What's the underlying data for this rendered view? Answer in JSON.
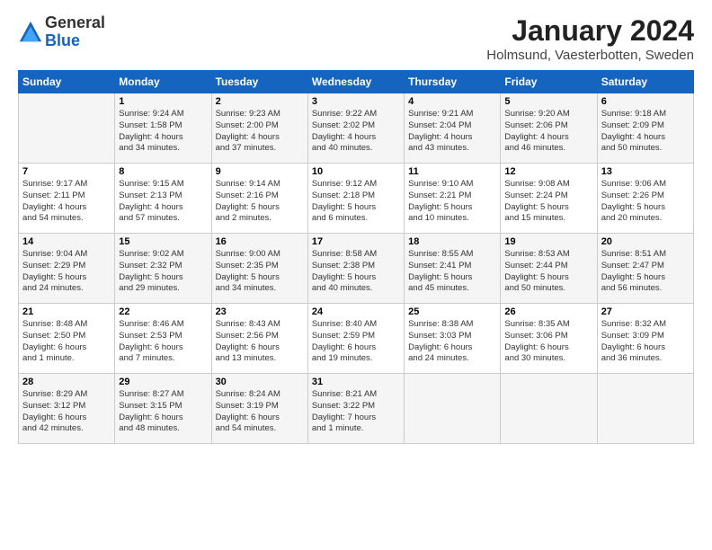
{
  "logo": {
    "general": "General",
    "blue": "Blue"
  },
  "title": "January 2024",
  "subtitle": "Holmsund, Vaesterbotten, Sweden",
  "days_header": [
    "Sunday",
    "Monday",
    "Tuesday",
    "Wednesday",
    "Thursday",
    "Friday",
    "Saturday"
  ],
  "weeks": [
    [
      {
        "num": "",
        "info": ""
      },
      {
        "num": "1",
        "info": "Sunrise: 9:24 AM\nSunset: 1:58 PM\nDaylight: 4 hours\nand 34 minutes."
      },
      {
        "num": "2",
        "info": "Sunrise: 9:23 AM\nSunset: 2:00 PM\nDaylight: 4 hours\nand 37 minutes."
      },
      {
        "num": "3",
        "info": "Sunrise: 9:22 AM\nSunset: 2:02 PM\nDaylight: 4 hours\nand 40 minutes."
      },
      {
        "num": "4",
        "info": "Sunrise: 9:21 AM\nSunset: 2:04 PM\nDaylight: 4 hours\nand 43 minutes."
      },
      {
        "num": "5",
        "info": "Sunrise: 9:20 AM\nSunset: 2:06 PM\nDaylight: 4 hours\nand 46 minutes."
      },
      {
        "num": "6",
        "info": "Sunrise: 9:18 AM\nSunset: 2:09 PM\nDaylight: 4 hours\nand 50 minutes."
      }
    ],
    [
      {
        "num": "7",
        "info": "Sunrise: 9:17 AM\nSunset: 2:11 PM\nDaylight: 4 hours\nand 54 minutes."
      },
      {
        "num": "8",
        "info": "Sunrise: 9:15 AM\nSunset: 2:13 PM\nDaylight: 4 hours\nand 57 minutes."
      },
      {
        "num": "9",
        "info": "Sunrise: 9:14 AM\nSunset: 2:16 PM\nDaylight: 5 hours\nand 2 minutes."
      },
      {
        "num": "10",
        "info": "Sunrise: 9:12 AM\nSunset: 2:18 PM\nDaylight: 5 hours\nand 6 minutes."
      },
      {
        "num": "11",
        "info": "Sunrise: 9:10 AM\nSunset: 2:21 PM\nDaylight: 5 hours\nand 10 minutes."
      },
      {
        "num": "12",
        "info": "Sunrise: 9:08 AM\nSunset: 2:24 PM\nDaylight: 5 hours\nand 15 minutes."
      },
      {
        "num": "13",
        "info": "Sunrise: 9:06 AM\nSunset: 2:26 PM\nDaylight: 5 hours\nand 20 minutes."
      }
    ],
    [
      {
        "num": "14",
        "info": "Sunrise: 9:04 AM\nSunset: 2:29 PM\nDaylight: 5 hours\nand 24 minutes."
      },
      {
        "num": "15",
        "info": "Sunrise: 9:02 AM\nSunset: 2:32 PM\nDaylight: 5 hours\nand 29 minutes."
      },
      {
        "num": "16",
        "info": "Sunrise: 9:00 AM\nSunset: 2:35 PM\nDaylight: 5 hours\nand 34 minutes."
      },
      {
        "num": "17",
        "info": "Sunrise: 8:58 AM\nSunset: 2:38 PM\nDaylight: 5 hours\nand 40 minutes."
      },
      {
        "num": "18",
        "info": "Sunrise: 8:55 AM\nSunset: 2:41 PM\nDaylight: 5 hours\nand 45 minutes."
      },
      {
        "num": "19",
        "info": "Sunrise: 8:53 AM\nSunset: 2:44 PM\nDaylight: 5 hours\nand 50 minutes."
      },
      {
        "num": "20",
        "info": "Sunrise: 8:51 AM\nSunset: 2:47 PM\nDaylight: 5 hours\nand 56 minutes."
      }
    ],
    [
      {
        "num": "21",
        "info": "Sunrise: 8:48 AM\nSunset: 2:50 PM\nDaylight: 6 hours\nand 1 minute."
      },
      {
        "num": "22",
        "info": "Sunrise: 8:46 AM\nSunset: 2:53 PM\nDaylight: 6 hours\nand 7 minutes."
      },
      {
        "num": "23",
        "info": "Sunrise: 8:43 AM\nSunset: 2:56 PM\nDaylight: 6 hours\nand 13 minutes."
      },
      {
        "num": "24",
        "info": "Sunrise: 8:40 AM\nSunset: 2:59 PM\nDaylight: 6 hours\nand 19 minutes."
      },
      {
        "num": "25",
        "info": "Sunrise: 8:38 AM\nSunset: 3:03 PM\nDaylight: 6 hours\nand 24 minutes."
      },
      {
        "num": "26",
        "info": "Sunrise: 8:35 AM\nSunset: 3:06 PM\nDaylight: 6 hours\nand 30 minutes."
      },
      {
        "num": "27",
        "info": "Sunrise: 8:32 AM\nSunset: 3:09 PM\nDaylight: 6 hours\nand 36 minutes."
      }
    ],
    [
      {
        "num": "28",
        "info": "Sunrise: 8:29 AM\nSunset: 3:12 PM\nDaylight: 6 hours\nand 42 minutes."
      },
      {
        "num": "29",
        "info": "Sunrise: 8:27 AM\nSunset: 3:15 PM\nDaylight: 6 hours\nand 48 minutes."
      },
      {
        "num": "30",
        "info": "Sunrise: 8:24 AM\nSunset: 3:19 PM\nDaylight: 6 hours\nand 54 minutes."
      },
      {
        "num": "31",
        "info": "Sunrise: 8:21 AM\nSunset: 3:22 PM\nDaylight: 7 hours\nand 1 minute."
      },
      {
        "num": "",
        "info": ""
      },
      {
        "num": "",
        "info": ""
      },
      {
        "num": "",
        "info": ""
      }
    ]
  ]
}
